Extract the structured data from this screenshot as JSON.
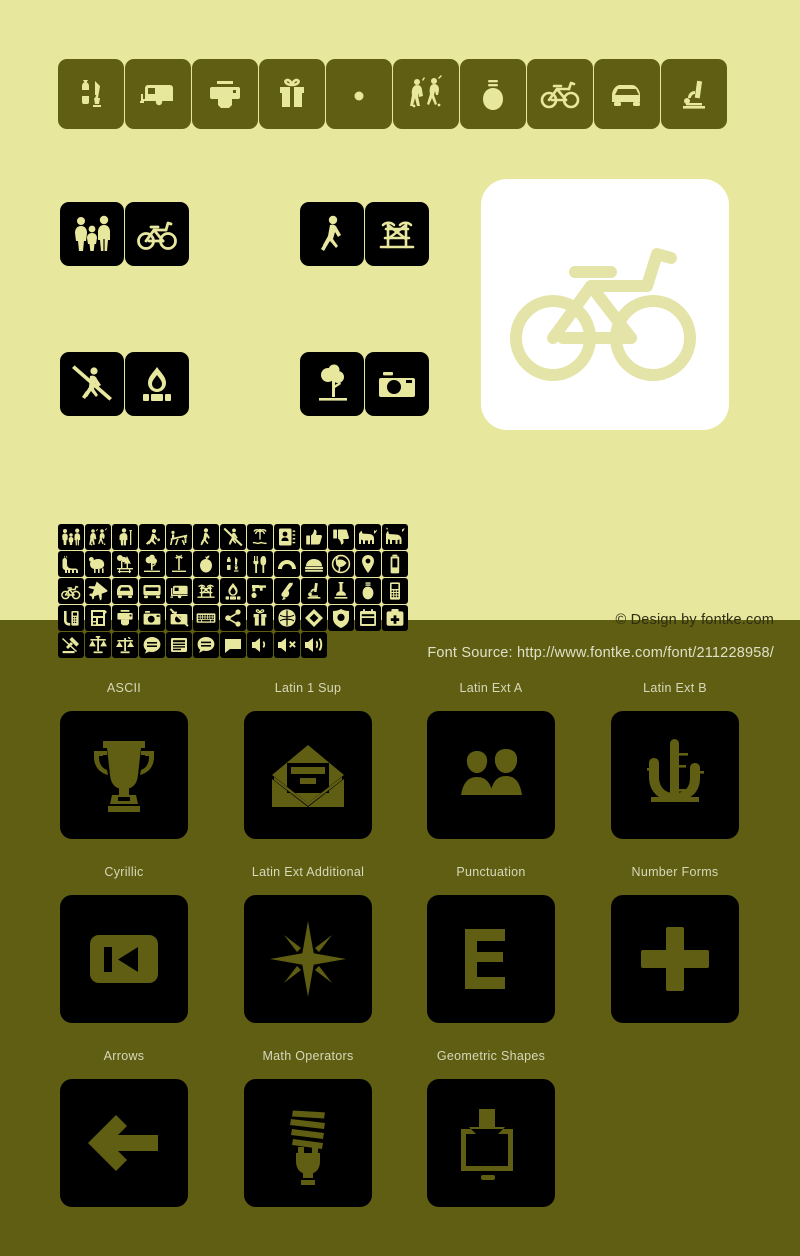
{
  "page": {
    "background_top": "#e8e79e",
    "background_bottom": "#5f5e12",
    "ink_dark": "#000000",
    "ink_light": "#e8e79e"
  },
  "credits": {
    "design": "© Design by fontke.com",
    "source": "Font Source: http://www.fontke.com/font/211228958/"
  },
  "header_strip": {
    "icons": [
      "cosmetics-icon",
      "caravan-icon",
      "printer-icon",
      "gift-icon",
      "dot-icon",
      "dancers-icon",
      "lightbulb-icon",
      "bicycle-icon",
      "car-front-icon",
      "microscope-icon"
    ]
  },
  "tile_groups": [
    {
      "name": "group-family-bicycle",
      "icons": [
        "family-icon",
        "bicycle-icon"
      ]
    },
    {
      "name": "group-walking-bridge",
      "icons": [
        "pedestrian-icon",
        "bridge-icon"
      ]
    },
    {
      "name": "group-no-hiking-campfire",
      "icons": [
        "no-hiking-icon",
        "campfire-icon"
      ]
    },
    {
      "name": "group-tree-camera",
      "icons": [
        "tree-icon",
        "camera-icon"
      ]
    }
  ],
  "big_panel": {
    "icon": "bicycle-icon",
    "background": "#ffffff",
    "glyph_color": "#e4e4a8"
  },
  "glyph_grid": {
    "rows": [
      [
        "family-icon",
        "dancers-icon",
        "elderly-icon",
        "runner-icon",
        "seesaw-icon",
        "walking-icon",
        "no-walking-icon",
        "palm-beach-icon",
        "contacts-icon",
        "thumbs-up-icon",
        "thumbs-down-icon",
        "dog-icon",
        "goat-icon"
      ],
      [
        "llama-icon",
        "sheep-icon",
        "picnic-trees-icon",
        "tree-icon",
        "palm-tree-icon",
        "apple-icon",
        "cosmetics-icon",
        "cutlery-icon",
        "rainbow-icon",
        "bed-icon",
        "globe-icon",
        "map-pin-icon",
        "battery-icon"
      ],
      [
        "bicycle-icon",
        "airplane-icon",
        "car-front-icon",
        "bus-icon",
        "caravan-icon",
        "bridge-icon",
        "campfire-icon",
        "faucet-icon",
        "magnet-icon",
        "microscope-icon",
        "lab-flask-icon",
        "lightbulb-icon",
        "mobile-phone-icon"
      ],
      [
        "telephone-icon",
        "calculator-icon",
        "printer-icon",
        "camera-icon",
        "no-photo-icon",
        "keyboard-icon",
        "share-icon",
        "gift-icon",
        "brain-icon",
        "diamond-badge-icon",
        "shield-icon",
        "calendar-icon",
        "first-aid-icon"
      ],
      [
        "gavel-icon",
        "scales-icon",
        "scales-alt-icon",
        "speech-ellipsis-icon",
        "document-icon",
        "chat-bubble-icon",
        "chat-square-icon",
        "volume-low-icon",
        "volume-mute-icon",
        "volume-high-icon"
      ]
    ]
  },
  "sample_grid": {
    "rows": [
      {
        "cells": [
          {
            "label": "ASCII",
            "icon": "trophy-icon"
          },
          {
            "label": "Latin 1 Sup",
            "icon": "open-envelope-icon"
          },
          {
            "label": "Latin Ext A",
            "icon": "two-people-icon"
          },
          {
            "label": "Latin Ext B",
            "icon": "cactus-icon"
          }
        ]
      },
      {
        "cells": [
          {
            "label": "Cyrillic",
            "icon": "skip-previous-icon"
          },
          {
            "label": "Latin Ext Additional",
            "icon": "compass-star-icon"
          },
          {
            "label": "Punctuation",
            "icon": "letter-e-icon"
          },
          {
            "label": "Number Forms",
            "icon": "plus-icon"
          }
        ]
      },
      {
        "cells": [
          {
            "label": "Arrows",
            "icon": "arrow-left-icon"
          },
          {
            "label": "Math Operators",
            "icon": "cfl-bulb-icon"
          },
          {
            "label": "Geometric Shapes",
            "icon": "download-monitor-icon"
          }
        ]
      }
    ]
  }
}
